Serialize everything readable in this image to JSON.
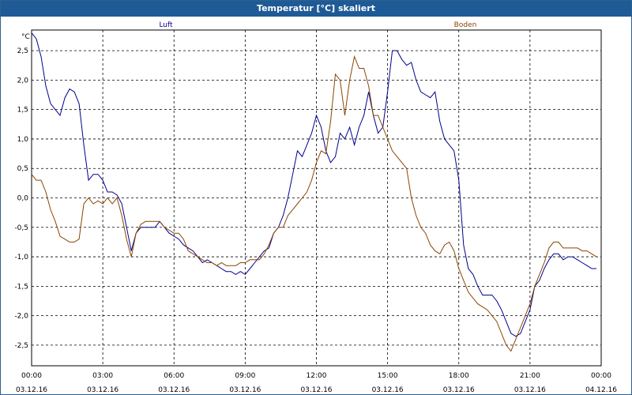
{
  "window": {
    "title": "Temperatur [°C] skaliert"
  },
  "chart_data": {
    "type": "line",
    "title": "Temperatur [°C] skaliert",
    "ylabel": "°C",
    "xlabel": "",
    "ylim": [
      -2.85,
      2.85
    ],
    "xlim": [
      "03.12.16 00:00",
      "04.12.16 00:00"
    ],
    "grid": true,
    "legend": "top",
    "yticks": [
      "2,5",
      "2,0",
      "1,5",
      "1,0",
      "0,5",
      "0,0",
      "-0,5",
      "-1,0",
      "-1,5",
      "-2,0",
      "-2,5"
    ],
    "ytick_values": [
      2.5,
      2.0,
      1.5,
      1.0,
      0.5,
      0.0,
      -0.5,
      -1.0,
      -1.5,
      -2.0,
      -2.5
    ],
    "xticks": [
      {
        "time": "00:00",
        "date": "03.12.16"
      },
      {
        "time": "03:00",
        "date": "03.12.16"
      },
      {
        "time": "06:00",
        "date": "03.12.16"
      },
      {
        "time": "09:00",
        "date": "03.12.16"
      },
      {
        "time": "12:00",
        "date": "03.12.16"
      },
      {
        "time": "15:00",
        "date": "03.12.16"
      },
      {
        "time": "18:00",
        "date": "03.12.16"
      },
      {
        "time": "21:00",
        "date": "03.12.16"
      },
      {
        "time": "00:00",
        "date": "04.12.16"
      }
    ],
    "series": [
      {
        "name": "Luft",
        "color": "#00008b",
        "points": [
          [
            0.0,
            2.8
          ],
          [
            0.2,
            2.7
          ],
          [
            0.4,
            2.4
          ],
          [
            0.6,
            1.9
          ],
          [
            0.8,
            1.6
          ],
          [
            1.0,
            1.5
          ],
          [
            1.2,
            1.4
          ],
          [
            1.4,
            1.7
          ],
          [
            1.6,
            1.85
          ],
          [
            1.8,
            1.8
          ],
          [
            2.0,
            1.6
          ],
          [
            2.2,
            0.9
          ],
          [
            2.4,
            0.3
          ],
          [
            2.6,
            0.4
          ],
          [
            2.8,
            0.4
          ],
          [
            3.0,
            0.3
          ],
          [
            3.2,
            0.1
          ],
          [
            3.4,
            0.1
          ],
          [
            3.6,
            0.05
          ],
          [
            3.8,
            -0.1
          ],
          [
            4.0,
            -0.5
          ],
          [
            4.2,
            -0.9
          ],
          [
            4.4,
            -0.6
          ],
          [
            4.6,
            -0.5
          ],
          [
            4.8,
            -0.5
          ],
          [
            5.0,
            -0.5
          ],
          [
            5.2,
            -0.5
          ],
          [
            5.4,
            -0.4
          ],
          [
            5.6,
            -0.5
          ],
          [
            5.8,
            -0.6
          ],
          [
            6.0,
            -0.65
          ],
          [
            6.2,
            -0.7
          ],
          [
            6.4,
            -0.8
          ],
          [
            6.6,
            -0.85
          ],
          [
            6.8,
            -0.9
          ],
          [
            7.0,
            -1.0
          ],
          [
            7.2,
            -1.1
          ],
          [
            7.4,
            -1.05
          ],
          [
            7.6,
            -1.1
          ],
          [
            7.8,
            -1.15
          ],
          [
            8.0,
            -1.2
          ],
          [
            8.2,
            -1.25
          ],
          [
            8.4,
            -1.25
          ],
          [
            8.6,
            -1.3
          ],
          [
            8.8,
            -1.25
          ],
          [
            9.0,
            -1.3
          ],
          [
            9.2,
            -1.2
          ],
          [
            9.4,
            -1.1
          ],
          [
            9.6,
            -1.0
          ],
          [
            9.8,
            -0.9
          ],
          [
            10.0,
            -0.85
          ],
          [
            10.2,
            -0.6
          ],
          [
            10.4,
            -0.5
          ],
          [
            10.6,
            -0.3
          ],
          [
            10.8,
            0.0
          ],
          [
            11.0,
            0.4
          ],
          [
            11.2,
            0.8
          ],
          [
            11.4,
            0.7
          ],
          [
            11.6,
            0.9
          ],
          [
            11.8,
            1.1
          ],
          [
            12.0,
            1.4
          ],
          [
            12.2,
            1.2
          ],
          [
            12.4,
            0.8
          ],
          [
            12.6,
            0.6
          ],
          [
            12.8,
            0.7
          ],
          [
            13.0,
            1.1
          ],
          [
            13.2,
            1.0
          ],
          [
            13.4,
            1.2
          ],
          [
            13.6,
            0.9
          ],
          [
            13.8,
            1.2
          ],
          [
            14.0,
            1.4
          ],
          [
            14.2,
            1.8
          ],
          [
            14.4,
            1.4
          ],
          [
            14.6,
            1.1
          ],
          [
            14.8,
            1.2
          ],
          [
            15.0,
            1.8
          ],
          [
            15.2,
            2.5
          ],
          [
            15.4,
            2.5
          ],
          [
            15.6,
            2.35
          ],
          [
            15.8,
            2.25
          ],
          [
            16.0,
            2.3
          ],
          [
            16.2,
            2.0
          ],
          [
            16.4,
            1.8
          ],
          [
            16.6,
            1.75
          ],
          [
            16.8,
            1.7
          ],
          [
            17.0,
            1.8
          ],
          [
            17.2,
            1.3
          ],
          [
            17.4,
            1.0
          ],
          [
            17.6,
            0.9
          ],
          [
            17.8,
            0.8
          ],
          [
            18.0,
            0.3
          ],
          [
            18.2,
            -0.8
          ],
          [
            18.4,
            -1.2
          ],
          [
            18.6,
            -1.3
          ],
          [
            18.8,
            -1.5
          ],
          [
            19.0,
            -1.65
          ],
          [
            19.2,
            -1.65
          ],
          [
            19.4,
            -1.65
          ],
          [
            19.6,
            -1.75
          ],
          [
            19.8,
            -1.9
          ],
          [
            20.0,
            -2.1
          ],
          [
            20.2,
            -2.3
          ],
          [
            20.4,
            -2.35
          ],
          [
            20.6,
            -2.3
          ],
          [
            20.8,
            -2.1
          ],
          [
            21.0,
            -1.9
          ],
          [
            21.2,
            -1.5
          ],
          [
            21.4,
            -1.4
          ],
          [
            21.6,
            -1.2
          ],
          [
            21.8,
            -1.05
          ],
          [
            22.0,
            -0.95
          ],
          [
            22.2,
            -0.95
          ],
          [
            22.4,
            -1.05
          ],
          [
            22.6,
            -1.0
          ],
          [
            22.8,
            -1.0
          ],
          [
            23.0,
            -1.05
          ],
          [
            23.2,
            -1.1
          ],
          [
            23.4,
            -1.15
          ],
          [
            23.6,
            -1.2
          ],
          [
            23.8,
            -1.2
          ]
        ]
      },
      {
        "name": "Boden",
        "color": "#8b4500",
        "points": [
          [
            0.0,
            0.4
          ],
          [
            0.2,
            0.3
          ],
          [
            0.4,
            0.3
          ],
          [
            0.6,
            0.1
          ],
          [
            0.8,
            -0.2
          ],
          [
            1.0,
            -0.4
          ],
          [
            1.2,
            -0.65
          ],
          [
            1.4,
            -0.7
          ],
          [
            1.6,
            -0.75
          ],
          [
            1.8,
            -0.75
          ],
          [
            2.0,
            -0.7
          ],
          [
            2.2,
            -0.1
          ],
          [
            2.4,
            0.0
          ],
          [
            2.6,
            -0.1
          ],
          [
            2.8,
            -0.05
          ],
          [
            3.0,
            -0.1
          ],
          [
            3.2,
            0.0
          ],
          [
            3.4,
            -0.1
          ],
          [
            3.6,
            0.0
          ],
          [
            3.8,
            -0.3
          ],
          [
            4.0,
            -0.7
          ],
          [
            4.2,
            -1.0
          ],
          [
            4.4,
            -0.6
          ],
          [
            4.6,
            -0.45
          ],
          [
            4.8,
            -0.4
          ],
          [
            5.0,
            -0.4
          ],
          [
            5.2,
            -0.4
          ],
          [
            5.4,
            -0.4
          ],
          [
            5.6,
            -0.5
          ],
          [
            5.8,
            -0.55
          ],
          [
            6.0,
            -0.6
          ],
          [
            6.2,
            -0.6
          ],
          [
            6.4,
            -0.7
          ],
          [
            6.6,
            -0.9
          ],
          [
            6.8,
            -0.95
          ],
          [
            7.0,
            -1.0
          ],
          [
            7.2,
            -1.05
          ],
          [
            7.4,
            -1.1
          ],
          [
            7.6,
            -1.1
          ],
          [
            7.8,
            -1.15
          ],
          [
            8.0,
            -1.1
          ],
          [
            8.2,
            -1.15
          ],
          [
            8.4,
            -1.15
          ],
          [
            8.6,
            -1.15
          ],
          [
            8.8,
            -1.1
          ],
          [
            9.0,
            -1.1
          ],
          [
            9.2,
            -1.05
          ],
          [
            9.4,
            -1.05
          ],
          [
            9.6,
            -1.05
          ],
          [
            9.8,
            -0.95
          ],
          [
            10.0,
            -0.8
          ],
          [
            10.2,
            -0.6
          ],
          [
            10.4,
            -0.5
          ],
          [
            10.6,
            -0.5
          ],
          [
            10.8,
            -0.3
          ],
          [
            11.0,
            -0.2
          ],
          [
            11.2,
            -0.1
          ],
          [
            11.4,
            0.0
          ],
          [
            11.6,
            0.1
          ],
          [
            11.8,
            0.3
          ],
          [
            12.0,
            0.6
          ],
          [
            12.2,
            0.8
          ],
          [
            12.4,
            0.75
          ],
          [
            12.6,
            1.3
          ],
          [
            12.8,
            2.1
          ],
          [
            13.0,
            2.0
          ],
          [
            13.2,
            1.4
          ],
          [
            13.4,
            2.0
          ],
          [
            13.6,
            2.4
          ],
          [
            13.8,
            2.2
          ],
          [
            14.0,
            2.2
          ],
          [
            14.2,
            1.9
          ],
          [
            14.4,
            1.4
          ],
          [
            14.6,
            1.4
          ],
          [
            14.8,
            1.2
          ],
          [
            15.0,
            1.0
          ],
          [
            15.2,
            0.8
          ],
          [
            15.4,
            0.7
          ],
          [
            15.6,
            0.6
          ],
          [
            15.8,
            0.5
          ],
          [
            16.0,
            0.0
          ],
          [
            16.2,
            -0.3
          ],
          [
            16.4,
            -0.5
          ],
          [
            16.6,
            -0.6
          ],
          [
            16.8,
            -0.8
          ],
          [
            17.0,
            -0.9
          ],
          [
            17.2,
            -0.95
          ],
          [
            17.4,
            -0.8
          ],
          [
            17.6,
            -0.75
          ],
          [
            17.8,
            -0.9
          ],
          [
            18.0,
            -1.2
          ],
          [
            18.2,
            -1.4
          ],
          [
            18.4,
            -1.6
          ],
          [
            18.6,
            -1.7
          ],
          [
            18.8,
            -1.8
          ],
          [
            19.0,
            -1.85
          ],
          [
            19.2,
            -1.9
          ],
          [
            19.4,
            -2.0
          ],
          [
            19.6,
            -2.1
          ],
          [
            19.8,
            -2.3
          ],
          [
            20.0,
            -2.5
          ],
          [
            20.2,
            -2.6
          ],
          [
            20.4,
            -2.4
          ],
          [
            20.6,
            -2.2
          ],
          [
            20.8,
            -2.0
          ],
          [
            21.0,
            -1.8
          ],
          [
            21.2,
            -1.5
          ],
          [
            21.4,
            -1.3
          ],
          [
            21.6,
            -1.1
          ],
          [
            21.8,
            -0.85
          ],
          [
            22.0,
            -0.75
          ],
          [
            22.2,
            -0.75
          ],
          [
            22.4,
            -0.85
          ],
          [
            22.6,
            -0.85
          ],
          [
            22.8,
            -0.85
          ],
          [
            23.0,
            -0.85
          ],
          [
            23.2,
            -0.9
          ],
          [
            23.4,
            -0.9
          ],
          [
            23.6,
            -0.95
          ],
          [
            23.8,
            -1.0
          ]
        ]
      }
    ]
  }
}
